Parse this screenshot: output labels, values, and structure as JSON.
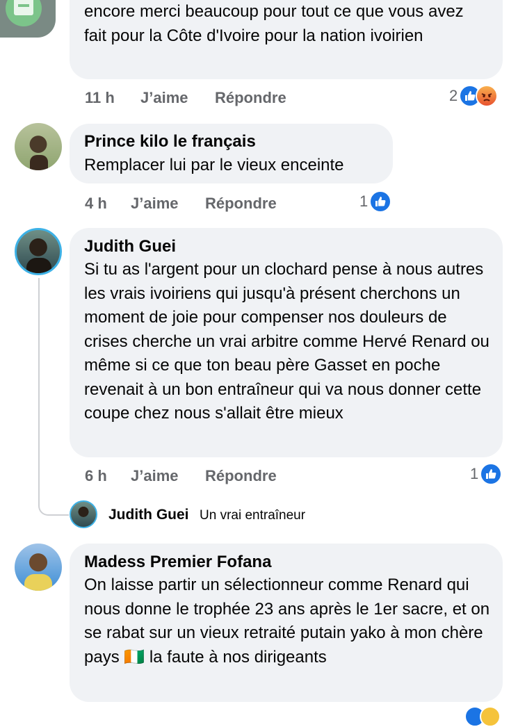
{
  "comments": [
    {
      "text": "encore merci beaucoup pour tout ce que vous avez fait pour la Côte d'Ivoire pour la nation ivoirien",
      "time": "11 h",
      "like": "J’aime",
      "reply": "Répondre",
      "reactions": "2",
      "reaction_icons": [
        "like-icon",
        "angry-icon"
      ]
    },
    {
      "author": "Prince kilo le français",
      "text": "Remplacer lui par le vieux enceinte",
      "time": "4 h",
      "like": "J’aime",
      "reply": "Répondre",
      "reactions": "1",
      "reaction_icons": [
        "like-icon"
      ]
    },
    {
      "author": "Judith Guei",
      "text": "Si tu as l'argent pour un clochard pense à nous autres les vrais ivoiriens qui jusqu'à présent cherchons un moment de joie pour compenser nos douleurs de crises cherche un vrai arbitre comme Hervé Renard ou même si ce que ton beau père Gasset en poche revenait à un bon entraîneur qui va nous donner cette coupe chez nous s'allait être mieux",
      "time": "6 h",
      "like": "J’aime",
      "reply": "Répondre",
      "reactions": "1",
      "reaction_icons": [
        "like-icon"
      ],
      "reply_preview": {
        "author": "Judith Guei",
        "text": "Un vrai entraîneur"
      }
    },
    {
      "author": "Madess Premier Fofana",
      "text": "On laisse partir un sélectionneur comme Renard qui nous donne le trophée 23 ans après le 1er sacre, et on se rabat sur un vieux retraité putain yako à mon chère pays 🇨🇮 la faute à nos dirigeants"
    }
  ],
  "colors": {
    "bubble": "#f0f2f5",
    "meta": "#65676b",
    "like_blue": "#1b74e4",
    "text": "#050505"
  }
}
